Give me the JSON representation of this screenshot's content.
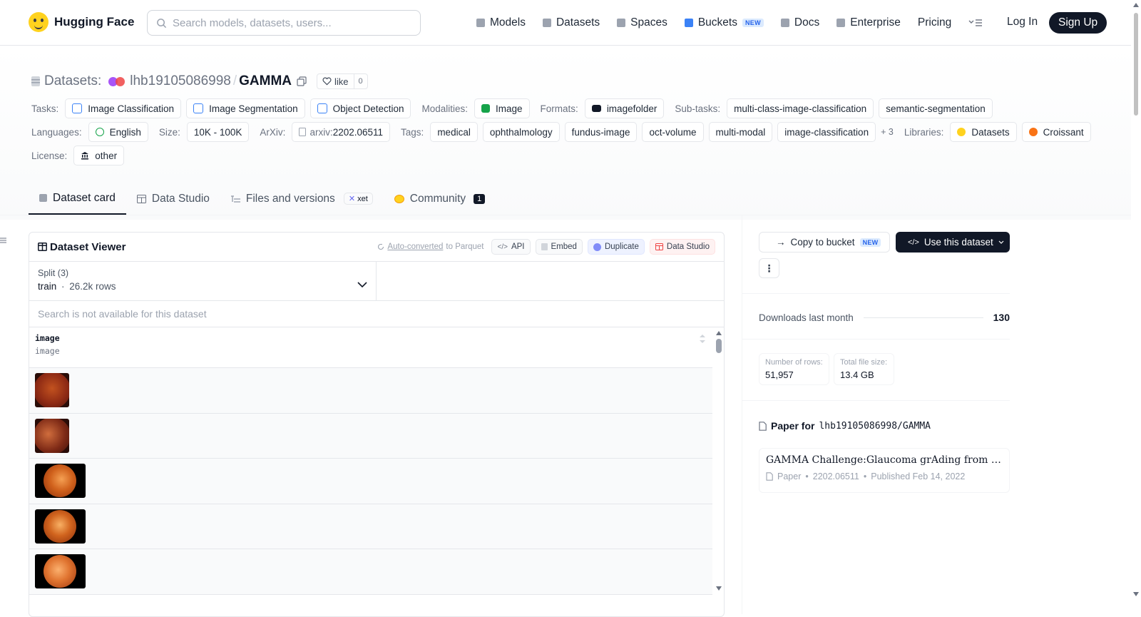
{
  "nav": {
    "brand": "Hugging Face",
    "search_placeholder": "Search models, datasets, users...",
    "links": [
      {
        "label": "Models",
        "icon": "models-icon"
      },
      {
        "label": "Datasets",
        "icon": "datasets-icon"
      },
      {
        "label": "Spaces",
        "icon": "spaces-icon"
      },
      {
        "label": "Buckets",
        "icon": "buckets-icon",
        "badge": "NEW"
      },
      {
        "label": "Docs",
        "icon": "docs-icon"
      },
      {
        "label": "Enterprise",
        "icon": "enterprise-icon"
      },
      {
        "label": "Pricing"
      }
    ],
    "login": "Log In",
    "signup": "Sign Up"
  },
  "repo": {
    "section": "Datasets:",
    "owner": "lhb19105086998",
    "name": "GAMMA",
    "like_label": "like",
    "like_count": "0"
  },
  "meta": {
    "tasks_label": "Tasks:",
    "tasks": [
      "Image Classification",
      "Image Segmentation",
      "Object Detection"
    ],
    "modalities_label": "Modalities:",
    "modalities": [
      "Image"
    ],
    "formats_label": "Formats:",
    "formats": [
      "imagefolder"
    ],
    "subtasks_label": "Sub-tasks:",
    "subtasks": [
      "multi-class-image-classification",
      "semantic-segmentation"
    ],
    "languages_label": "Languages:",
    "languages": [
      "English"
    ],
    "size_label": "Size:",
    "size": "10K - 100K",
    "arxiv_label": "ArXiv:",
    "arxiv_prefix": "arxiv:",
    "arxiv_id": "2202.06511",
    "tags_label": "Tags:",
    "tags": [
      "medical",
      "ophthalmology",
      "fundus-image",
      "oct-volume",
      "multi-modal",
      "image-classification"
    ],
    "tags_more": "+ 3",
    "libraries_label": "Libraries:",
    "libraries": [
      "Datasets",
      "Croissant"
    ],
    "license_label": "License:",
    "license": "other"
  },
  "tabs": [
    {
      "label": "Dataset card",
      "active": true
    },
    {
      "label": "Data Studio"
    },
    {
      "label": "Files and versions",
      "badge": "xet"
    },
    {
      "label": "Community",
      "count": "1"
    }
  ],
  "viewer": {
    "title": "Dataset Viewer",
    "auto_converted": "Auto-converted",
    "to_parquet": "to Parquet",
    "buttons": [
      "API",
      "Embed",
      "Duplicate",
      "Data Studio"
    ],
    "split_label": "Split (3)",
    "split_value": "train",
    "split_rows": "26.2k rows",
    "search_note": "Search is not available for this dataset",
    "column_name": "image",
    "column_type": "image",
    "row_count_shown": 5
  },
  "sidebar": {
    "copy_label": "Copy to bucket",
    "copy_badge": "NEW",
    "use_label": "Use this dataset",
    "downloads_label": "Downloads last month",
    "downloads": "130",
    "rows_label": "Number of rows:",
    "rows": "51,957",
    "filesize_label": "Total file size:",
    "filesize": "13.4 GB",
    "paper_heading": "Paper for",
    "paper_repo": "lhb19105086998/GAMMA",
    "paper_title": "GAMMA Challenge:Glaucoma grAding from Multi-Modality imAges",
    "paper_kind": "Paper",
    "paper_id": "2202.06511",
    "paper_published": "Published Feb 14, 2022"
  }
}
